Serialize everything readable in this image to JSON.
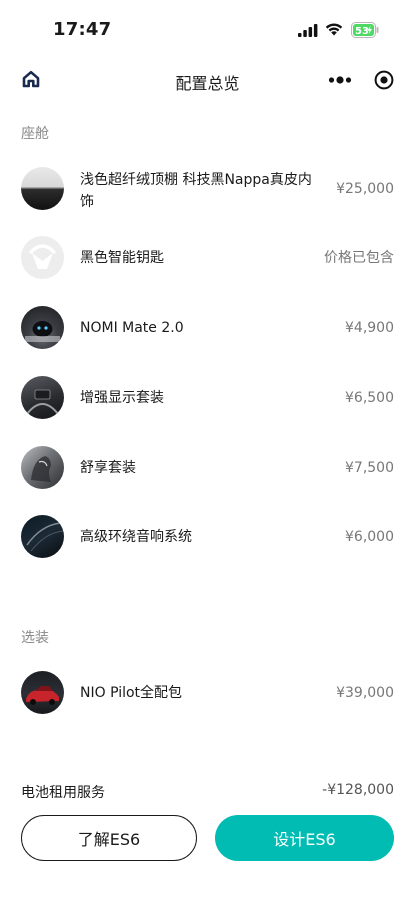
{
  "status_bar": {
    "time": "17:47",
    "battery": "53"
  },
  "nav": {
    "title": "配置总览"
  },
  "sections": {
    "cabin": "座舱",
    "options": "选装"
  },
  "cabin_items": [
    {
      "name": "浅色超纤绒顶棚 科技黑Nappa真皮内饰",
      "price": "¥25,000",
      "thumb_icon": "headliner-swatch"
    },
    {
      "name": "黑色智能钥匙",
      "price": "价格已包含",
      "thumb_icon": "nio-logo"
    },
    {
      "name": "NOMI Mate 2.0",
      "price": "¥4,900",
      "thumb_icon": "nomi-robot"
    },
    {
      "name": "增强显示套装",
      "price": "¥6,500",
      "thumb_icon": "display-cluster"
    },
    {
      "name": "舒享套装",
      "price": "¥7,500",
      "thumb_icon": "seat"
    },
    {
      "name": "高级环绕音响系统",
      "price": "¥6,000",
      "thumb_icon": "speaker-trim"
    }
  ],
  "option_items": [
    {
      "name": "NIO Pilot全配包",
      "price": "¥39,000",
      "thumb_icon": "red-car"
    }
  ],
  "battery_service": {
    "label": "电池租用服务",
    "price": "-¥128,000"
  },
  "buttons": {
    "learn": "了解ES6",
    "design": "设计ES6"
  },
  "colors": {
    "accent": "#00bcb2",
    "battery_green": "#4cd964"
  }
}
